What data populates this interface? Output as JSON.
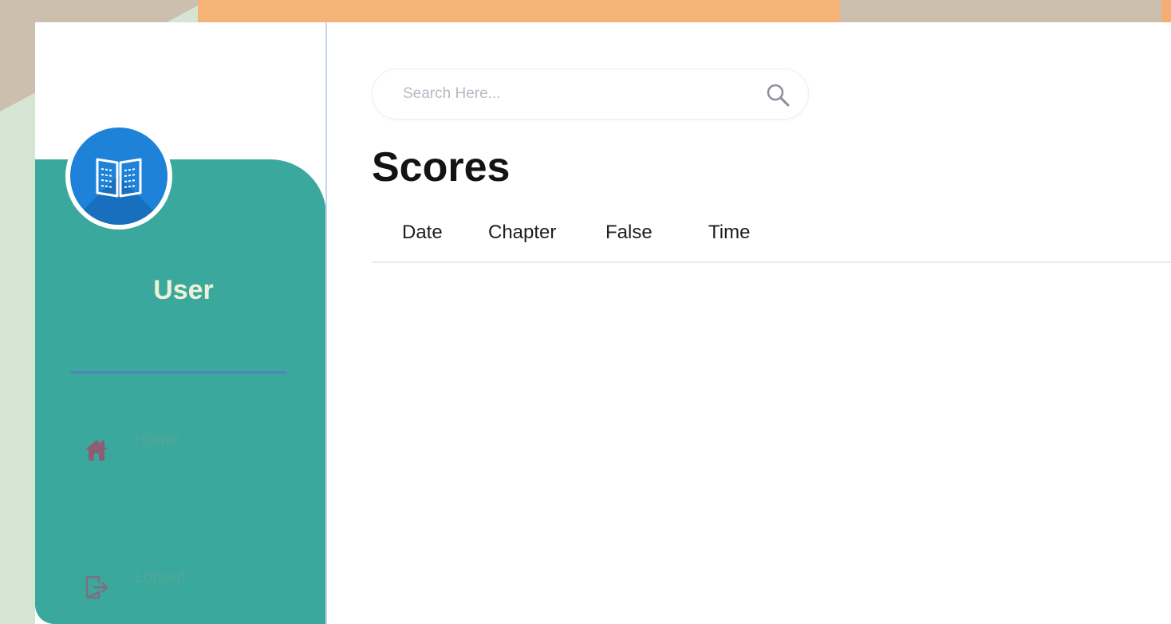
{
  "sidebar": {
    "user_name": "User",
    "items": [
      {
        "label": "Home",
        "icon": "home-icon"
      },
      {
        "label": "Logout",
        "icon": "logout-icon"
      }
    ],
    "logo_icon": "book-icon"
  },
  "search": {
    "placeholder": "Search Here...",
    "value": "",
    "icon": "search-icon"
  },
  "main": {
    "title": "Scores",
    "table": {
      "columns": [
        "Date",
        "Chapter",
        "False",
        "Time"
      ],
      "rows": []
    }
  },
  "colors": {
    "sidebar_panel": "#3aa89c",
    "logo_blue": "#1e82d8",
    "accent_orange": "#f6b377",
    "background_green": "#d6e5d3"
  }
}
